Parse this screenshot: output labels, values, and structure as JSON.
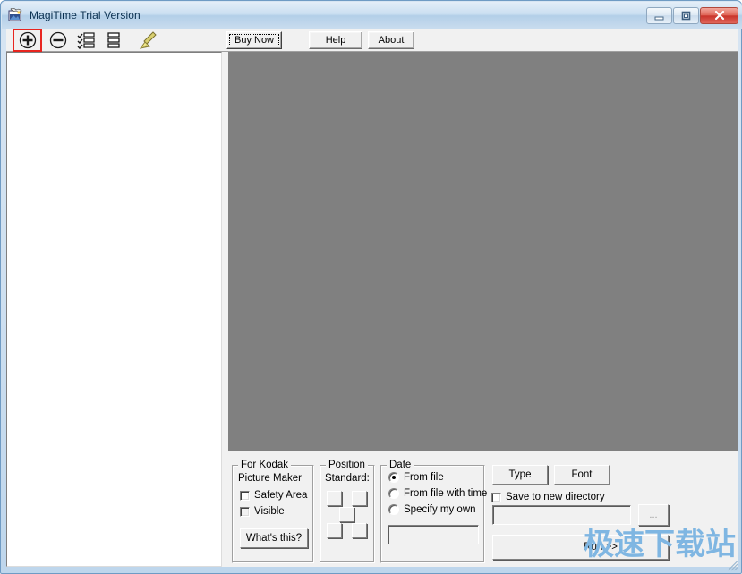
{
  "window": {
    "title": "MagiTime Trial Version",
    "app_icon": "photo-app-icon",
    "minimize_label": "minimize-icon",
    "maximize_label": "maximize-icon",
    "close_label": "close-icon",
    "accent_close_color": "#c9342a",
    "titlebar_color": "#b3cfe8",
    "frame_color": "#bed6ec"
  },
  "toolbar": {
    "tools": [
      {
        "name": "zoom-in-icon",
        "glyph": "plus-in-circle",
        "highlighted": true
      },
      {
        "name": "zoom-out-icon",
        "glyph": "minus-in-circle",
        "highlighted": false
      },
      {
        "name": "list-checked-icon",
        "glyph": "checklist",
        "highlighted": false
      },
      {
        "name": "list-icon",
        "glyph": "list",
        "highlighted": false
      },
      {
        "name": "broom-icon",
        "glyph": "broom",
        "highlighted": false
      }
    ],
    "buy_now_label": "Buy Now",
    "help_label": "Help",
    "about_label": "About",
    "highlight_color": "#e8251f"
  },
  "left_panel": {
    "name": "file-list-panel",
    "items": [],
    "background": "#ffffff"
  },
  "preview": {
    "name": "image-preview-area",
    "background": "#808080",
    "content": ""
  },
  "controls": {
    "kodak_group": {
      "caption": "For Kodak",
      "subtitle": "Picture Maker",
      "checkboxes": [
        {
          "label": "Safety Area",
          "checked": false,
          "disabled": false
        },
        {
          "label": "Visible",
          "checked": false,
          "disabled": true
        }
      ],
      "whats_this_label": "What's this?"
    },
    "position_group": {
      "caption": "Position",
      "subtitle": "Standard:",
      "cells": [
        {
          "name": "position-cell-top-left"
        },
        {
          "name": "position-cell-top-right"
        },
        {
          "name": "position-cell-center"
        },
        {
          "name": "position-cell-bottom-left"
        },
        {
          "name": "position-cell-bottom-right"
        }
      ]
    },
    "date_group": {
      "caption": "Date",
      "options": [
        {
          "label": "From file",
          "selected": true
        },
        {
          "label": "From file with time",
          "selected": false
        },
        {
          "label": "Specify my own",
          "selected": false
        }
      ],
      "custom_date_value": "",
      "custom_date_placeholder": ""
    },
    "type_label": "Type",
    "font_label": "Font",
    "save_to_new_directory": {
      "label": "Save to new directory",
      "checked": false
    },
    "directory_value": "",
    "directory_placeholder": "",
    "browse_label": "...",
    "run_label": "Run >>"
  },
  "watermark": {
    "text": "极速下载站",
    "color": "#7fb6e2"
  }
}
